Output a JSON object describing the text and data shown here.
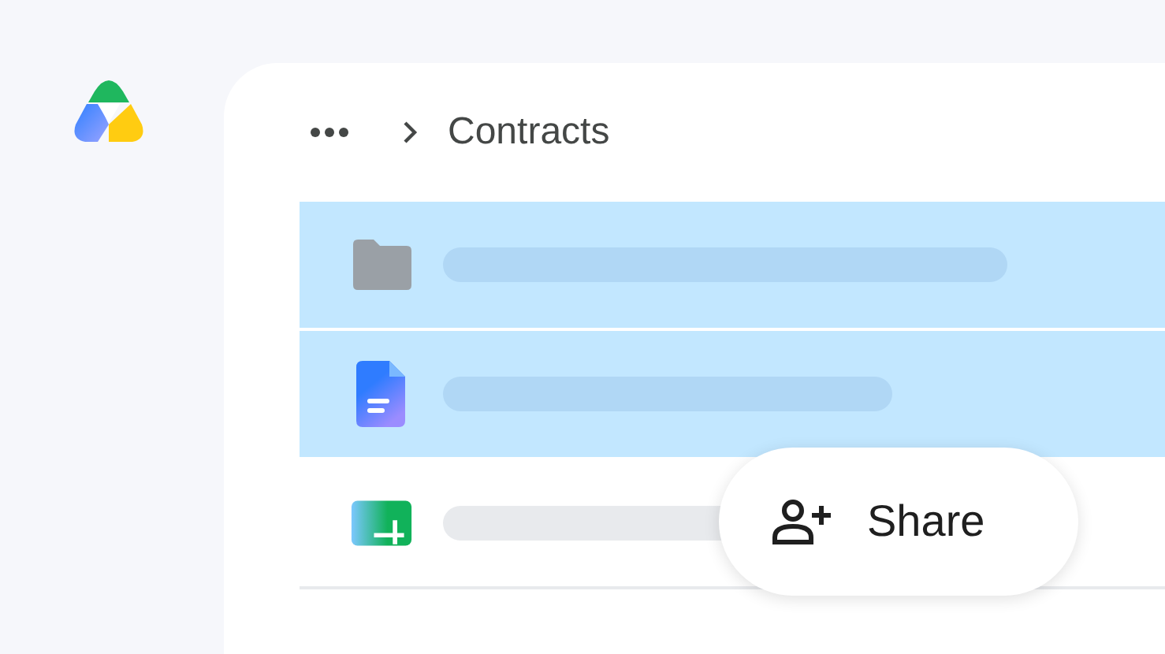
{
  "breadcrumb": {
    "current": "Contracts"
  },
  "rows": [
    {
      "kind": "folder",
      "selected": true
    },
    {
      "kind": "doc",
      "selected": true
    },
    {
      "kind": "sheet",
      "selected": false
    }
  ],
  "share_button": {
    "label": "Share"
  }
}
